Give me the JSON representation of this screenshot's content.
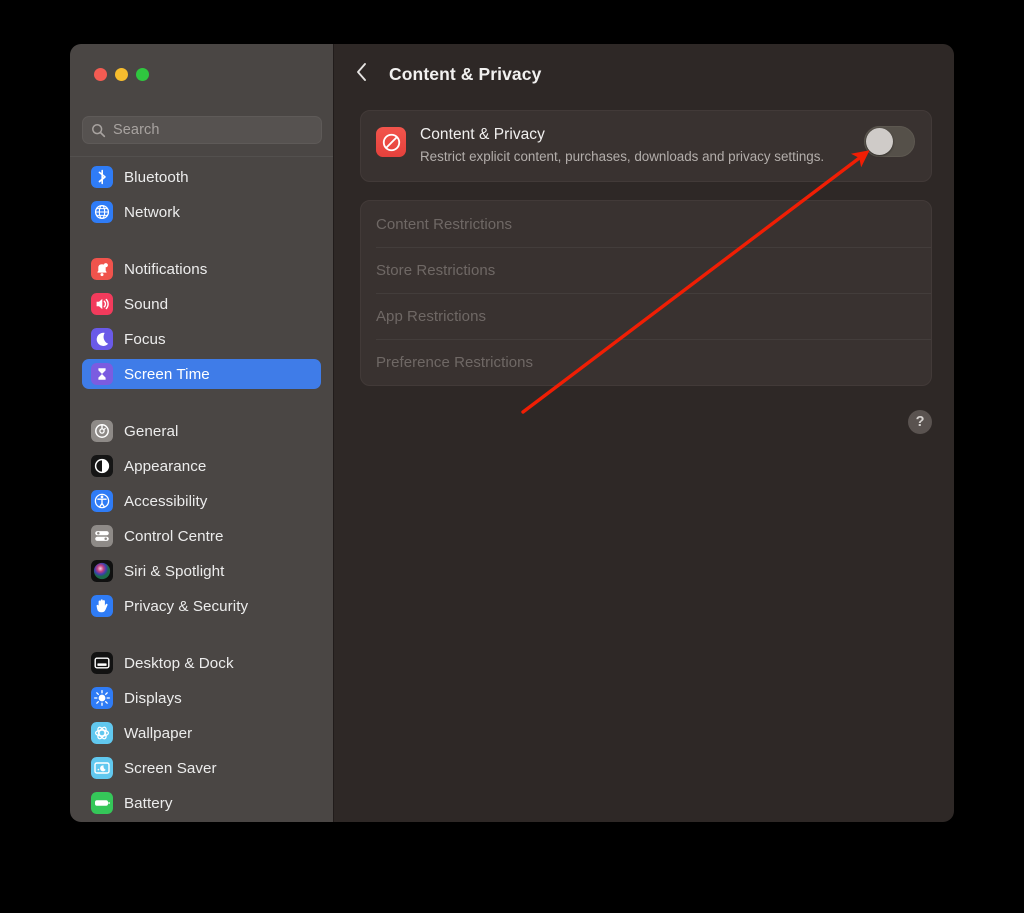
{
  "window": {
    "traffic_lights": [
      {
        "name": "close",
        "color": "#f35b52"
      },
      {
        "name": "minimize",
        "color": "#f7bd2e"
      },
      {
        "name": "maximize",
        "color": "#2fc73f"
      }
    ]
  },
  "sidebar": {
    "search": {
      "placeholder": "Search",
      "value": "",
      "icon": "search-icon"
    },
    "groups": [
      {
        "items": [
          {
            "label": "Bluetooth",
            "icon": "bluetooth-icon",
            "selected": false
          },
          {
            "label": "Network",
            "icon": "globe-icon",
            "selected": false
          }
        ]
      },
      {
        "items": [
          {
            "label": "Notifications",
            "icon": "bell-icon",
            "selected": false
          },
          {
            "label": "Sound",
            "icon": "speaker-icon",
            "selected": false
          },
          {
            "label": "Focus",
            "icon": "moon-icon",
            "selected": false
          },
          {
            "label": "Screen Time",
            "icon": "hourglass-icon",
            "selected": true
          }
        ]
      },
      {
        "items": [
          {
            "label": "General",
            "icon": "gear-icon",
            "selected": false
          },
          {
            "label": "Appearance",
            "icon": "contrast-icon",
            "selected": false
          },
          {
            "label": "Accessibility",
            "icon": "accessibility-icon",
            "selected": false
          },
          {
            "label": "Control Centre",
            "icon": "sliders-icon",
            "selected": false
          },
          {
            "label": "Siri & Spotlight",
            "icon": "siri-icon",
            "selected": false
          },
          {
            "label": "Privacy & Security",
            "icon": "hand-icon",
            "selected": false
          }
        ]
      },
      {
        "items": [
          {
            "label": "Desktop & Dock",
            "icon": "desktop-icon",
            "selected": false
          },
          {
            "label": "Displays",
            "icon": "brightness-icon",
            "selected": false
          },
          {
            "label": "Wallpaper",
            "icon": "wallpaper-icon",
            "selected": false
          },
          {
            "label": "Screen Saver",
            "icon": "screensaver-icon",
            "selected": false
          },
          {
            "label": "Battery",
            "icon": "battery-icon",
            "selected": false
          }
        ]
      }
    ],
    "selected_accent": "#3f7ce8"
  },
  "main": {
    "back_icon": "chevron-left-icon",
    "title": "Content & Privacy",
    "privacy_card": {
      "icon": "no-entry-icon",
      "icon_color": "#e5413c",
      "title": "Content & Privacy",
      "description": "Restrict explicit content, purchases, downloads and privacy settings.",
      "toggle": {
        "name": "content-privacy-toggle",
        "state": "off"
      }
    },
    "restrictions": [
      {
        "label": "Content Restrictions",
        "enabled": false
      },
      {
        "label": "Store Restrictions",
        "enabled": false
      },
      {
        "label": "App Restrictions",
        "enabled": false
      },
      {
        "label": "Preference Restrictions",
        "enabled": false
      }
    ],
    "help_button": {
      "label": "?",
      "name": "help-button"
    }
  },
  "annotation": {
    "arrow_color": "#f01e04",
    "points_to": "content-privacy-toggle"
  }
}
